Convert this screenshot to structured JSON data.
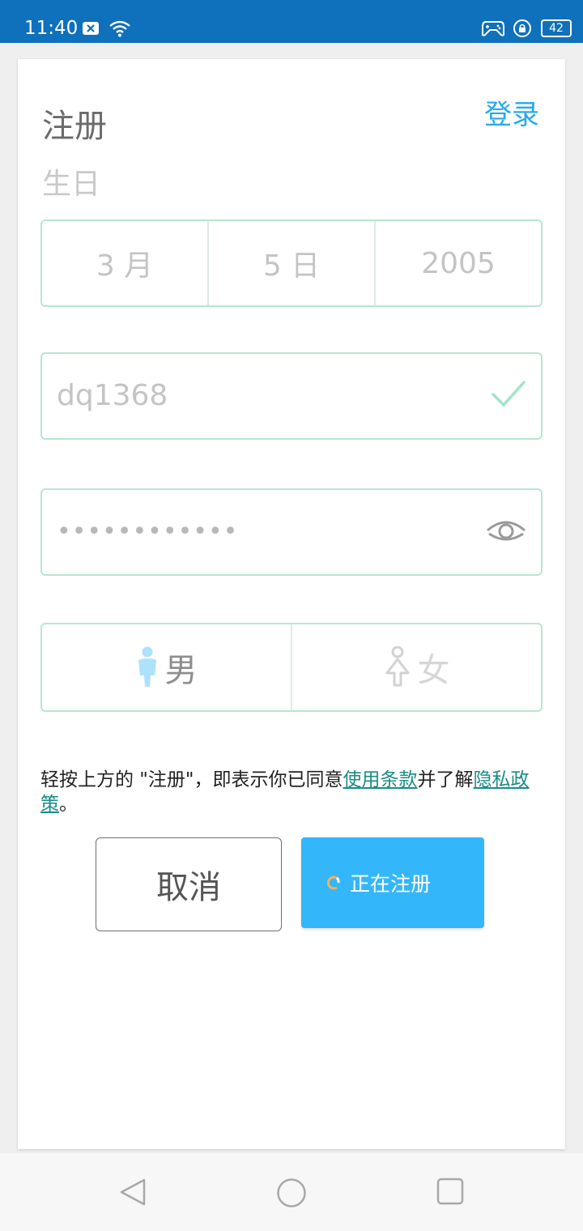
{
  "status_bar": {
    "time": "11:40",
    "battery": "42",
    "icons": [
      "close-badge-icon",
      "wifi-icon",
      "game-controller-icon",
      "rotation-lock-icon",
      "battery-icon"
    ]
  },
  "page": {
    "title": "注册",
    "login_link": "登录"
  },
  "birthday": {
    "label": "生日",
    "month": "3 月",
    "day": "5 日",
    "year": "2005"
  },
  "username": {
    "value": "dq1368",
    "valid_icon": "check-icon"
  },
  "password": {
    "masked_value": "••••••••••••",
    "toggle_icon": "eye-icon"
  },
  "gender": {
    "male_label": "男",
    "female_label": "女",
    "male_icon": "male-icon",
    "female_icon": "female-icon"
  },
  "terms": {
    "text_before": "轻按上方的 \"注册\"，即表示你已同意",
    "terms_link": "使用条款",
    "text_middle": "并了解",
    "privacy_link": "隐私政策",
    "text_after": "。"
  },
  "buttons": {
    "cancel": "取消",
    "register": "正在注册"
  },
  "colors": {
    "status_bar": "#0f70bb",
    "accent": "#34b6fa",
    "link": "#28a9ea",
    "field_border": "#b8e6d0",
    "terms_link": "#1b8c86"
  },
  "nav_bar": {
    "icons": [
      "back-icon",
      "home-icon",
      "recents-icon"
    ]
  }
}
